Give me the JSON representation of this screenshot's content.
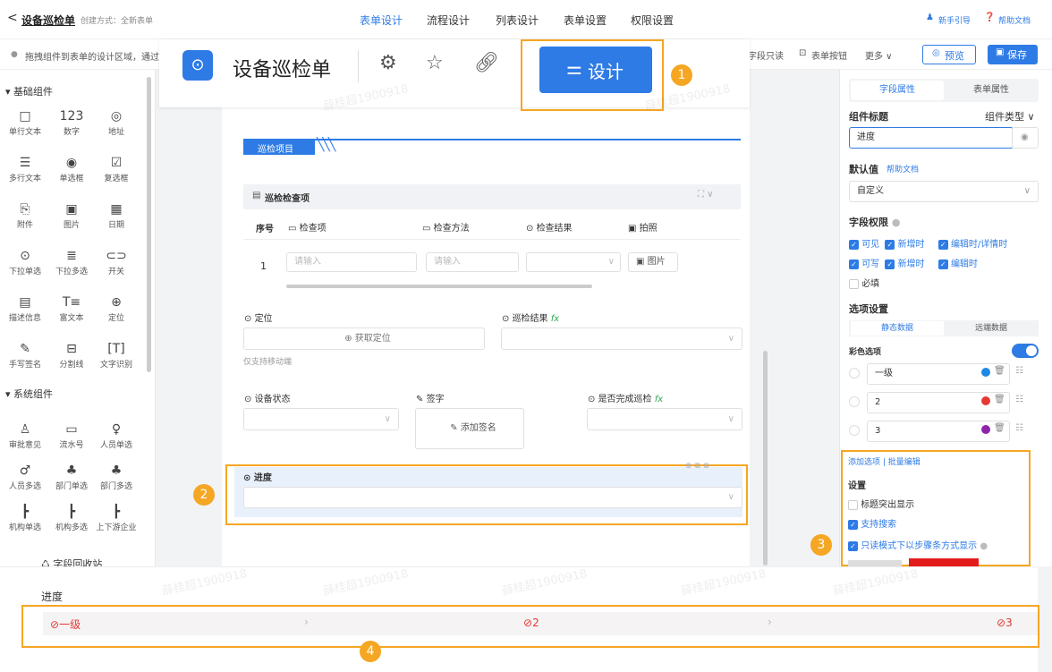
{
  "topbar": {
    "back_label": "<",
    "title": "设备巡检单",
    "create_mode": "创建方式：全新表单",
    "tabs": [
      "表单设计",
      "流程设计",
      "列表设计",
      "表单设置",
      "权限设置"
    ],
    "guide": "新手引导",
    "help": "帮助文档"
  },
  "toolbar2": {
    "hint": "拖拽组件到表单的设计区域，通过",
    "readonly": "字段只读",
    "form_buttons": "表单按钮",
    "more": "更多 ∨",
    "preview": "预览",
    "save": "保存"
  },
  "overlay_header": {
    "title": "设备巡检单",
    "design_button": "设计"
  },
  "left": {
    "basic_header": "基础组件",
    "basic": [
      {
        "icon": "□",
        "label": "单行文本"
      },
      {
        "icon": "123",
        "label": "数字"
      },
      {
        "icon": "◎",
        "label": "地址"
      },
      {
        "icon": "☰",
        "label": "多行文本"
      },
      {
        "icon": "◉",
        "label": "单选框"
      },
      {
        "icon": "☑",
        "label": "复选框"
      },
      {
        "icon": "⎘",
        "label": "附件"
      },
      {
        "icon": "▣",
        "label": "图片"
      },
      {
        "icon": "▦",
        "label": "日期"
      },
      {
        "icon": "⊙",
        "label": "下拉单选"
      },
      {
        "icon": "≣",
        "label": "下拉多选"
      },
      {
        "icon": "⊂⊃",
        "label": "开关"
      },
      {
        "icon": "▤",
        "label": "描述信息"
      },
      {
        "icon": "T≡",
        "label": "富文本"
      },
      {
        "icon": "⊕",
        "label": "定位"
      },
      {
        "icon": "✎",
        "label": "手写签名"
      },
      {
        "icon": "⊟",
        "label": "分割线"
      },
      {
        "icon": "[T]",
        "label": "文字识别"
      }
    ],
    "system_header": "系统组件",
    "system": [
      {
        "icon": "♙",
        "label": "审批意见"
      },
      {
        "icon": "▭",
        "label": "流水号"
      },
      {
        "icon": "♀",
        "label": "人员单选"
      },
      {
        "icon": "♂",
        "label": "人员多选"
      },
      {
        "icon": "♣",
        "label": "部门单选"
      },
      {
        "icon": "♣",
        "label": "部门多选"
      },
      {
        "icon": "┣",
        "label": "机构单选"
      },
      {
        "icon": "┣",
        "label": "机构多选"
      },
      {
        "icon": "┣",
        "label": "上下游企业"
      }
    ],
    "recycle": "字段回收站"
  },
  "form": {
    "section_title": "巡检项目",
    "table_title": "巡检检查项",
    "columns": [
      "序号",
      "检查项",
      "检查方法",
      "检查结果",
      "拍照"
    ],
    "row_index": "1",
    "input_placeholder": "请输入",
    "photo_button": "图片",
    "location_label": "定位",
    "get_location": "获取定位",
    "mobile_only": "仅支持移动端",
    "result_label": "巡检结果",
    "fx": "fx",
    "status_label": "设备状态",
    "signature_label": "签字",
    "add_signature": "添加签名",
    "completed_label": "是否完成巡检",
    "progress_label": "进度"
  },
  "right": {
    "tab_field": "字段属性",
    "tab_form": "表单属性",
    "comp_title": "组件标题",
    "comp_type": "组件类型 ∨",
    "title_value": "进度",
    "default_label": "默认值",
    "help_doc": "帮助文档",
    "default_value": "自定义",
    "perm_label": "字段权限",
    "perm_visible": "可见",
    "perm_add": "新增时",
    "perm_edit_detail": "编辑时/详情时",
    "perm_write": "可写",
    "perm_add2": "新增时",
    "perm_edit": "编辑时",
    "perm_required": "必填",
    "options_label": "选项设置",
    "static_data": "静态数据",
    "remote_data": "远端数据",
    "color_option": "彩色选项",
    "options": [
      {
        "label": "一级",
        "color": "#1e88e5"
      },
      {
        "label": "2",
        "color": "#e53935"
      },
      {
        "label": "3",
        "color": "#8e24aa"
      }
    ],
    "add_option": "添加选项",
    "batch_edit": "批量编辑",
    "settings_label": "设置",
    "s1": "标题突出显示",
    "s2": "支持搜索",
    "s3": "只读模式下以步骤条方式显示"
  },
  "preview": {
    "label": "进度",
    "steps": [
      "一级",
      "2",
      "3"
    ]
  },
  "badges": [
    "1",
    "2",
    "3",
    "4"
  ],
  "watermark": "薛桂超1900918",
  "colors": {
    "accent": "#2e7be5",
    "highlight": "#f5a623",
    "step_red": "#e53935"
  }
}
